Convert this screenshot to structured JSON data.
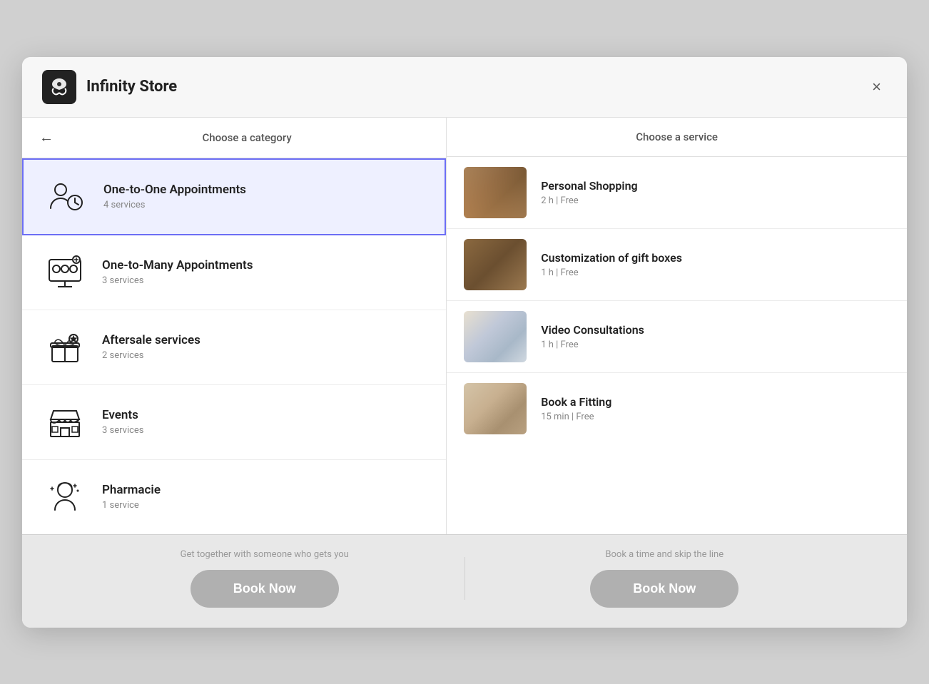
{
  "header": {
    "store_name": "Infinity Store",
    "close_label": "×"
  },
  "left_panel": {
    "back_label": "←",
    "title": "Choose a category",
    "categories": [
      {
        "id": "one-to-one",
        "name": "One-to-One Appointments",
        "count": "4 services",
        "active": true,
        "icon": "person-clock"
      },
      {
        "id": "one-to-many",
        "name": "One-to-Many Appointments",
        "count": "3 services",
        "active": false,
        "icon": "group-screen"
      },
      {
        "id": "aftersale",
        "name": "Aftersale services",
        "count": "2 services",
        "active": false,
        "icon": "gift-star"
      },
      {
        "id": "events",
        "name": "Events",
        "count": "3 services",
        "active": false,
        "icon": "store"
      },
      {
        "id": "pharmacie",
        "name": "Pharmacie",
        "count": "1 service",
        "active": false,
        "icon": "person-sparkle"
      }
    ]
  },
  "right_panel": {
    "title": "Choose a service",
    "services": [
      {
        "id": "personal-shopping",
        "name": "Personal Shopping",
        "duration": "2 h",
        "price": "Free",
        "thumb_class": "thumb-personal"
      },
      {
        "id": "gift-boxes",
        "name": "Customization of gift boxes",
        "duration": "1 h",
        "price": "Free",
        "thumb_class": "thumb-gift"
      },
      {
        "id": "video-consultations",
        "name": "Video Consultations",
        "duration": "1 h",
        "price": "Free",
        "thumb_class": "thumb-video"
      },
      {
        "id": "book-fitting",
        "name": "Book a Fitting",
        "duration": "15 min",
        "price": "Free",
        "thumb_class": "thumb-fitting"
      }
    ]
  },
  "footer": {
    "left_tagline": "Get together with someone who gets you",
    "right_tagline": "Book a time and skip the line",
    "book_now_label": "Book Now"
  }
}
